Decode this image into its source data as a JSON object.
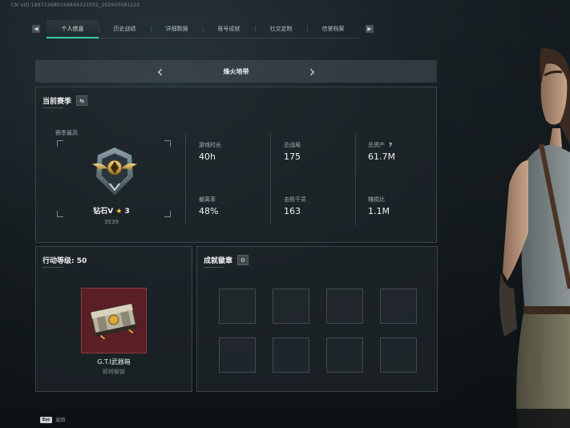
{
  "uid": "CN UID:188712680159849321052_202605081222",
  "tabs": [
    {
      "label": "个人信息",
      "active": true
    },
    {
      "label": "历史战绩"
    },
    {
      "label": "详细数据"
    },
    {
      "label": "账号成就"
    },
    {
      "label": "社交定制"
    },
    {
      "label": "信誉档案"
    }
  ],
  "tab_nav": {
    "prev": "◀",
    "next": "▶"
  },
  "season": {
    "title": "烽火地带",
    "prev_icon": "chevron-left-icon",
    "next_icon": "chevron-right-icon"
  },
  "current_season": {
    "title": "当前赛季",
    "switch_icon": "swap-icon",
    "best_label": "赛季最高",
    "rank_name": "钻石V",
    "rank_star": "★",
    "rank_stars_count": "3",
    "rank_score": "3539",
    "stats": [
      {
        "label": "游戏时长",
        "value": "40h"
      },
      {
        "label": "总战局",
        "value": "175"
      },
      {
        "label": "总资产",
        "value": "61.7M",
        "help": "?"
      },
      {
        "label": "撤离率",
        "value": "48%"
      },
      {
        "label": "击败干员",
        "value": "163"
      },
      {
        "label": "赚损比",
        "value": "1.1M"
      }
    ]
  },
  "action_level": {
    "title": "行动等级: 50",
    "item_name": "G.T.I武器箱",
    "item_status": "即将解锁"
  },
  "achievements": {
    "title": "成就徽章",
    "settings_icon": "gear-icon",
    "slots": 8
  },
  "bottom": {
    "key": "Esc",
    "label": "返回"
  },
  "colors": {
    "accent": "#35d0a0",
    "crate_bg": "#5a1f24",
    "star": "#f3c63a"
  }
}
